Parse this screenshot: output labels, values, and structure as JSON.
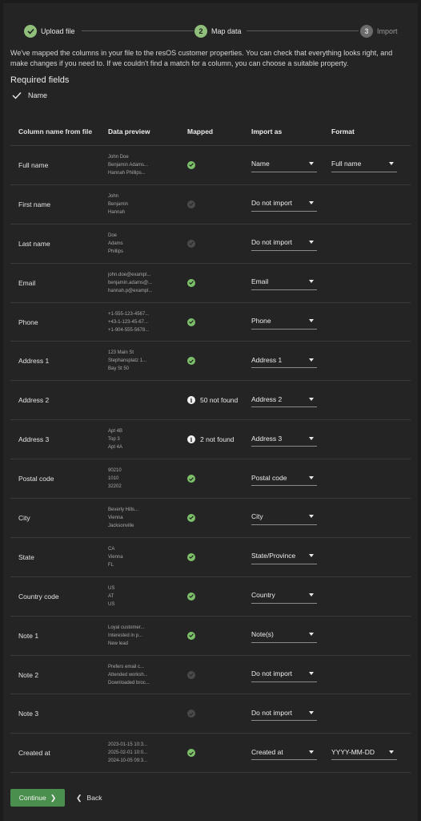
{
  "stepper": {
    "steps": [
      {
        "number": "1",
        "label": "Upload file",
        "state": "done"
      },
      {
        "number": "2",
        "label": "Map data",
        "state": "active"
      },
      {
        "number": "3",
        "label": "Import",
        "state": "todo"
      }
    ]
  },
  "intro": "We've mapped the columns in your file to the resOS customer properties. You can check that everything looks right, and make changes if you need to. If we couldn't find a match for a column, you can choose a suitable property.",
  "required": {
    "title": "Required fields",
    "items": [
      "Name"
    ]
  },
  "table": {
    "headers": [
      "Column name from file",
      "Data preview",
      "Mapped",
      "Import as",
      "Format"
    ],
    "rows": [
      {
        "column": "Full name",
        "preview": [
          "John Doe",
          "Benjamin Adams...",
          "Hannah Phillips..."
        ],
        "status": "ok",
        "status_text": "",
        "import_as": "Name",
        "format": "Full name"
      },
      {
        "column": "First name",
        "preview": [
          "John",
          "Benjamin",
          "Hannah"
        ],
        "status": "off",
        "status_text": "",
        "import_as": "Do not import",
        "format": ""
      },
      {
        "column": "Last name",
        "preview": [
          "Doe",
          "Adams",
          "Phillips"
        ],
        "status": "off",
        "status_text": "",
        "import_as": "Do not import",
        "format": ""
      },
      {
        "column": "Email",
        "preview": [
          "john.doe@exampl...",
          "benjamin.adams@...",
          "hannah.p@exampl..."
        ],
        "status": "ok",
        "status_text": "",
        "import_as": "Email",
        "format": ""
      },
      {
        "column": "Phone",
        "preview": [
          "+1-555-123-4567...",
          "+43-1-123-45-67...",
          "+1-904-555-5678..."
        ],
        "status": "ok",
        "status_text": "",
        "import_as": "Phone",
        "format": ""
      },
      {
        "column": "Address 1",
        "preview": [
          "123 Main St",
          "Stephansplatz 1...",
          "Bay St 50"
        ],
        "status": "ok",
        "status_text": "",
        "import_as": "Address 1",
        "format": ""
      },
      {
        "column": "Address 2",
        "preview": [],
        "status": "info",
        "status_text": "50 not found",
        "import_as": "Address 2",
        "format": ""
      },
      {
        "column": "Address 3",
        "preview": [
          "Apt 4B",
          "Top 3",
          "Apt 4A"
        ],
        "status": "info",
        "status_text": "2 not found",
        "import_as": "Address 3",
        "format": ""
      },
      {
        "column": "Postal code",
        "preview": [
          "90210",
          "1010",
          "32202"
        ],
        "status": "ok",
        "status_text": "",
        "import_as": "Postal code",
        "format": ""
      },
      {
        "column": "City",
        "preview": [
          "Beverly Hills...",
          "Vienna",
          "Jacksonville"
        ],
        "status": "ok",
        "status_text": "",
        "import_as": "City",
        "format": ""
      },
      {
        "column": "State",
        "preview": [
          "CA",
          "Vienna",
          "FL"
        ],
        "status": "ok",
        "status_text": "",
        "import_as": "State/Province",
        "format": ""
      },
      {
        "column": "Country code",
        "preview": [
          "US",
          "AT",
          "US"
        ],
        "status": "ok",
        "status_text": "",
        "import_as": "Country",
        "format": ""
      },
      {
        "column": "Note 1",
        "preview": [
          "Loyal customer...",
          "Interested in p...",
          "New lead"
        ],
        "status": "ok",
        "status_text": "",
        "import_as": "Note(s)",
        "format": ""
      },
      {
        "column": "Note 2",
        "preview": [
          "Prefers email c...",
          "Attended worksh...",
          "Downloaded broc..."
        ],
        "status": "off",
        "status_text": "",
        "import_as": "Do not import",
        "format": ""
      },
      {
        "column": "Note 3",
        "preview": [],
        "status": "off",
        "status_text": "",
        "import_as": "Do not import",
        "format": ""
      },
      {
        "column": "Created at",
        "preview": [
          "2023-01-15 10:3...",
          "2025-02-01 10:0...",
          "2024-10-05 09:3..."
        ],
        "status": "ok",
        "status_text": "",
        "import_as": "Created at",
        "format": "YYYY-MM-DD"
      }
    ]
  },
  "footer": {
    "continue_label": "Continue",
    "back_label": "Back"
  },
  "colors": {
    "accent": "#4b8f4e",
    "ok": "#7cc06a",
    "background": "#242424"
  }
}
